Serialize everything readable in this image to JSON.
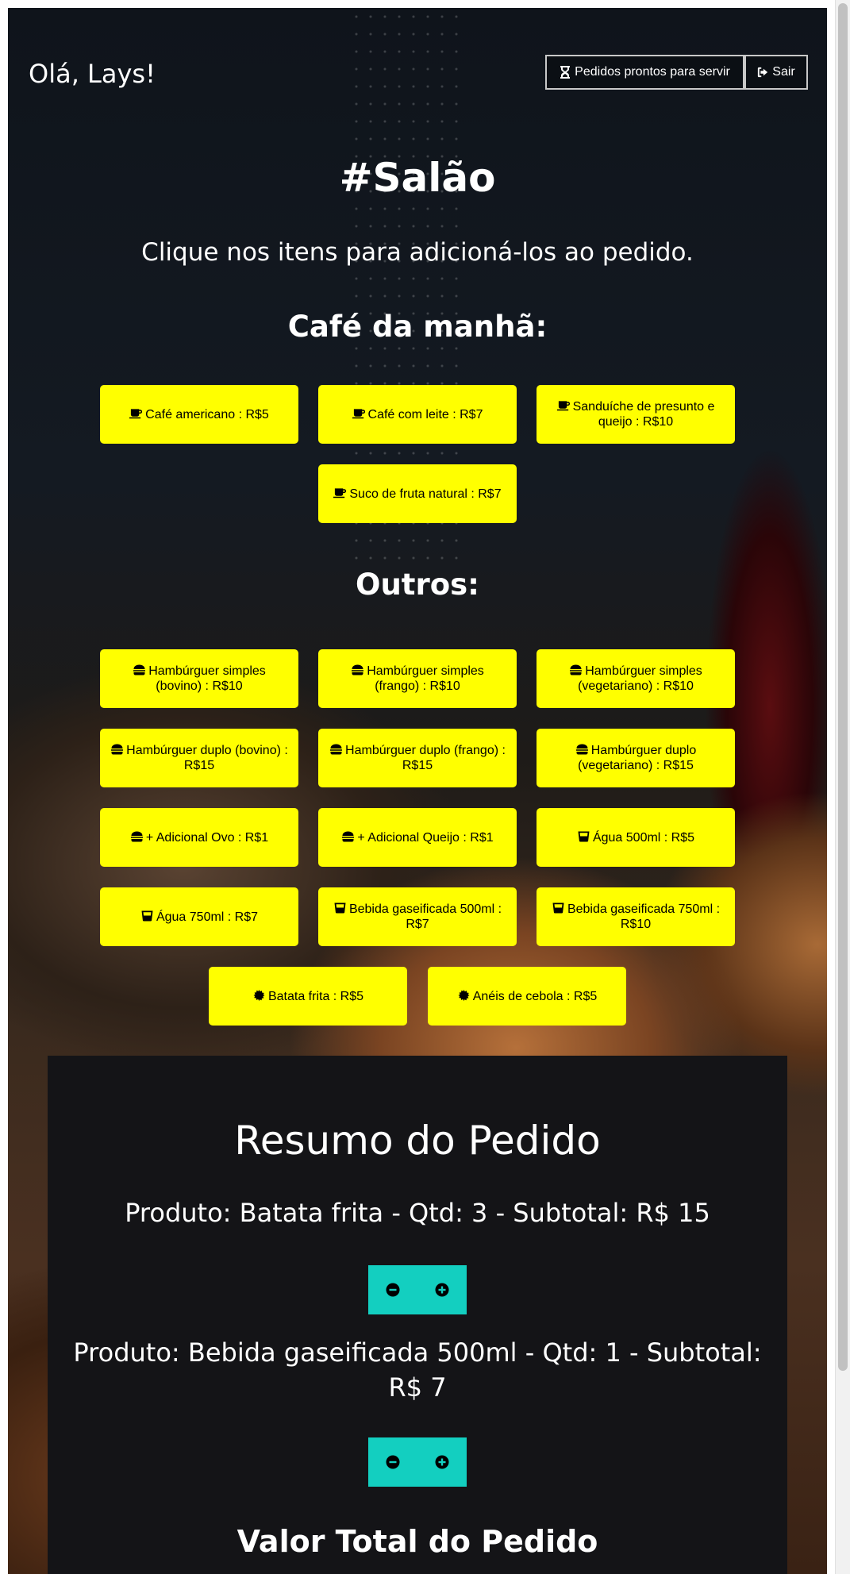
{
  "header": {
    "greeting": "Olá, Lays!",
    "ready_orders_label": "Pedidos prontos para servir",
    "exit_label": "Sair"
  },
  "page": {
    "title": "#Salão",
    "instruction": "Clique nos itens para adicioná-los ao pedido."
  },
  "breakfast": {
    "heading": "Café da manhã:",
    "items": [
      {
        "label": "Café americano : R$5",
        "icon": "coffee-cup-icon"
      },
      {
        "label": "Café com leite : R$7",
        "icon": "coffee-cup-icon"
      },
      {
        "label": "Sanduíche de presunto e queijo : R$10",
        "icon": "coffee-cup-icon"
      },
      {
        "label": "Suco de fruta natural : R$7",
        "icon": "coffee-cup-icon"
      }
    ]
  },
  "others": {
    "heading": "Outros:",
    "items": [
      {
        "label": "Hambúrguer simples (bovino) : R$10",
        "icon": "burger-icon"
      },
      {
        "label": "Hambúrguer simples (frango) : R$10",
        "icon": "burger-icon"
      },
      {
        "label": "Hambúrguer simples (vegetariano) : R$10",
        "icon": "burger-icon"
      },
      {
        "label": "Hambúrguer duplo (bovino) : R$15",
        "icon": "burger-icon"
      },
      {
        "label": "Hambúrguer duplo (frango) : R$15",
        "icon": "burger-icon"
      },
      {
        "label": "Hambúrguer duplo (vegetariano) : R$15",
        "icon": "burger-icon"
      },
      {
        "label": "+ Adicional Ovo : R$1",
        "icon": "burger-icon"
      },
      {
        "label": "+ Adicional Queijo : R$1",
        "icon": "burger-icon"
      },
      {
        "label": "Água 500ml : R$5",
        "icon": "glass-icon"
      },
      {
        "label": "Água 750ml : R$7",
        "icon": "glass-icon"
      },
      {
        "label": "Bebida gaseificada 500ml : R$7",
        "icon": "glass-icon"
      },
      {
        "label": "Bebida gaseificada 750ml : R$10",
        "icon": "glass-icon"
      },
      {
        "label": "Batata frita : R$5",
        "icon": "burst-icon"
      },
      {
        "label": "Anéis de cebola : R$5",
        "icon": "burst-icon"
      }
    ]
  },
  "summary": {
    "title": "Resumo do Pedido",
    "lines": [
      "Produto: Batata frita - Qtd: 3 - Subtotal: R$ 15",
      "Produto: Bebida gaseificada 500ml - Qtd: 1 - Subtotal: R$ 7"
    ],
    "total_title": "Valor Total do Pedido"
  },
  "colors": {
    "item_bg": "#ffff00",
    "qty_button": "#13cfc0",
    "summary_bg": "#141417"
  }
}
